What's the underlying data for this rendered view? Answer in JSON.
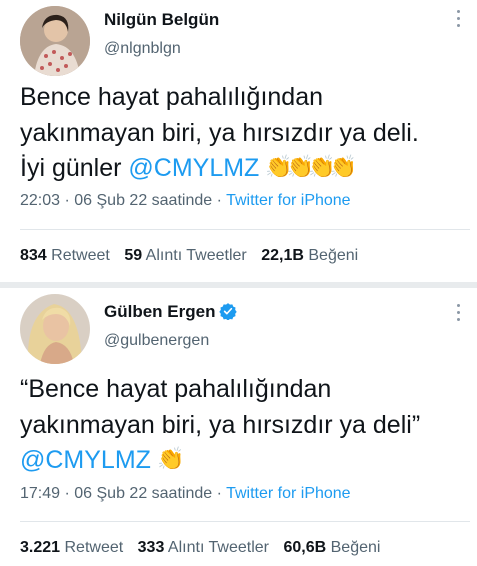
{
  "tweets": [
    {
      "name": "Nilgün Belgün",
      "handle": "@nlgnblgn",
      "verified": false,
      "text_line1": "Bence hayat pahalılığından",
      "text_line2": "yakınmayan biri, ya hırsızdır ya deli.",
      "text_line3_prefix": "İyi günler ",
      "mention": "@CMYLMZ",
      "emoji": "👏👏👏👏",
      "time": "22:03 · 06 Şub 22 saatinde · ",
      "source": "Twitter for iPhone",
      "retweets_count": "834",
      "retweets_label": "Retweet",
      "quotes_count": "59",
      "quotes_label": "Alıntı Tweetler",
      "likes_count": "22,1B",
      "likes_label": "Beğeni"
    },
    {
      "name": "Gülben Ergen",
      "handle": "@gulbenergen",
      "verified": true,
      "text_line1": "“Bence hayat pahalılığından",
      "text_line2": "yakınmayan biri, ya hırsızdır ya deli”",
      "mention": "@CMYLMZ",
      "emoji": "👏",
      "time": "17:49 · 06 Şub 22 saatinde · ",
      "source": "Twitter for iPhone",
      "retweets_count": "3.221",
      "retweets_label": "Retweet",
      "quotes_count": "333",
      "quotes_label": "Alıntı Tweetler",
      "likes_count": "60,6B",
      "likes_label": "Beğeni"
    }
  ],
  "colors": {
    "link": "#1d9bf0",
    "text": "#0f1419",
    "secondary": "#536471",
    "verified": "#1d9bf0"
  },
  "icons": [
    "avatar-image",
    "more-options-icon",
    "verified-badge-icon",
    "clapping-hands-emoji"
  ]
}
